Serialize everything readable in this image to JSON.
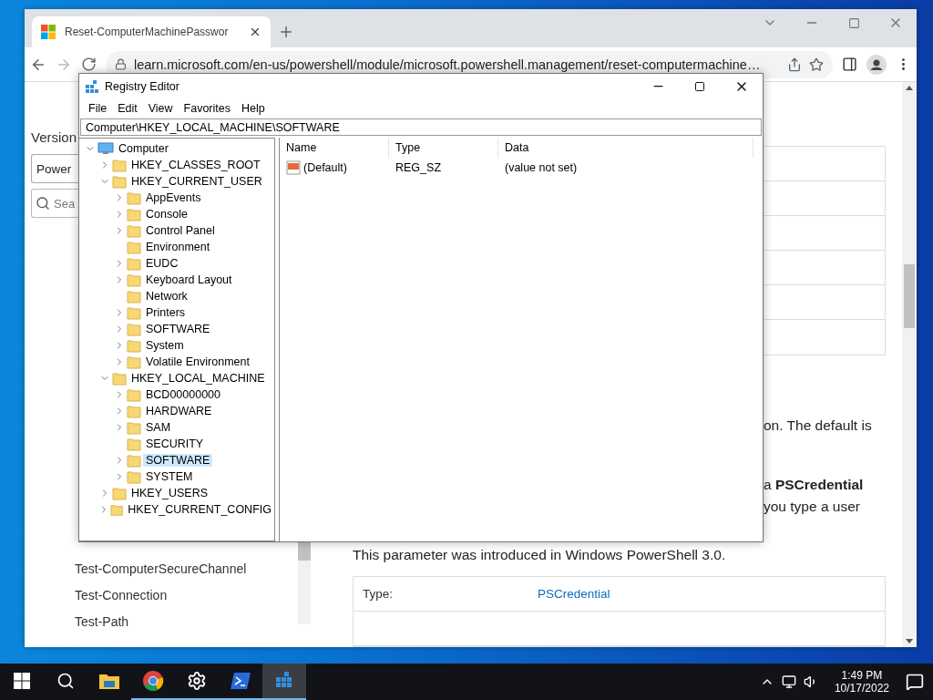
{
  "browser": {
    "tab": {
      "title": "Reset-ComputerMachinePasswor",
      "selected": true
    },
    "address": "learn.microsoft.com/en-us/powershell/module/microsoft.powershell.management/reset-computermachine…",
    "forward_disabled": true,
    "sidebar": {
      "heading": "Version",
      "version_value": "Power",
      "search_placeholder": "Sea",
      "items": [
        "Test-ComputerSecureChannel",
        "Test-Connection",
        "Test-Path"
      ]
    },
    "content": {
      "fragments": [
        "on. The default is",
        "a **PSCredential**",
        "you type a user"
      ],
      "paragraph": "This parameter was introduced in Windows PowerShell 3.0.",
      "param_table": [
        {
          "label": "Type:",
          "value": "PSCredential"
        }
      ]
    }
  },
  "regedit": {
    "title": "Registry Editor",
    "menu": [
      "File",
      "Edit",
      "View",
      "Favorites",
      "Help"
    ],
    "address": "Computer\\HKEY_LOCAL_MACHINE\\SOFTWARE",
    "tree": [
      {
        "label": "Computer",
        "kind": "computer",
        "expandable": true,
        "expanded": true,
        "selected": false,
        "children": [
          {
            "label": "HKEY_CLASSES_ROOT",
            "expandable": true,
            "expanded": false,
            "selected": false
          },
          {
            "label": "HKEY_CURRENT_USER",
            "expandable": true,
            "expanded": true,
            "selected": false,
            "children": [
              {
                "label": "AppEvents",
                "expandable": true,
                "expanded": false,
                "selected": false
              },
              {
                "label": "Console",
                "expandable": true,
                "expanded": false,
                "selected": false
              },
              {
                "label": "Control Panel",
                "expandable": true,
                "expanded": false,
                "selected": false
              },
              {
                "label": "Environment",
                "expandable": false,
                "expanded": false,
                "selected": false
              },
              {
                "label": "EUDC",
                "expandable": true,
                "expanded": false,
                "selected": false
              },
              {
                "label": "Keyboard Layout",
                "expandable": true,
                "expanded": false,
                "selected": false
              },
              {
                "label": "Network",
                "expandable": false,
                "expanded": false,
                "selected": false
              },
              {
                "label": "Printers",
                "expandable": true,
                "expanded": false,
                "selected": false
              },
              {
                "label": "SOFTWARE",
                "expandable": true,
                "expanded": false,
                "selected": false
              },
              {
                "label": "System",
                "expandable": true,
                "expanded": false,
                "selected": false
              },
              {
                "label": "Volatile Environment",
                "expandable": true,
                "expanded": false,
                "selected": false
              }
            ]
          },
          {
            "label": "HKEY_LOCAL_MACHINE",
            "expandable": true,
            "expanded": true,
            "selected": false,
            "children": [
              {
                "label": "BCD00000000",
                "expandable": true,
                "expanded": false,
                "selected": false
              },
              {
                "label": "HARDWARE",
                "expandable": true,
                "expanded": false,
                "selected": false
              },
              {
                "label": "SAM",
                "expandable": true,
                "expanded": false,
                "selected": false
              },
              {
                "label": "SECURITY",
                "expandable": false,
                "expanded": false,
                "selected": false
              },
              {
                "label": "SOFTWARE",
                "expandable": true,
                "expanded": false,
                "selected": true
              },
              {
                "label": "SYSTEM",
                "expandable": true,
                "expanded": false,
                "selected": false
              }
            ]
          },
          {
            "label": "HKEY_USERS",
            "expandable": true,
            "expanded": false,
            "selected": false
          },
          {
            "label": "HKEY_CURRENT_CONFIG",
            "expandable": true,
            "expanded": false,
            "selected": false
          }
        ]
      }
    ],
    "columns": [
      "Name",
      "Type",
      "Data"
    ],
    "values": [
      {
        "name": "(Default)",
        "type": "REG_SZ",
        "data": "(value not set)"
      }
    ]
  },
  "taskbar": {
    "apps": [
      {
        "kind": "explorer",
        "running": false,
        "selected": false
      },
      {
        "kind": "chrome",
        "running": true,
        "selected": false
      },
      {
        "kind": "settings",
        "running": true,
        "selected": false
      },
      {
        "kind": "powershell",
        "running": true,
        "selected": false
      },
      {
        "kind": "regedit",
        "running": true,
        "selected": true
      }
    ],
    "time": "1:49 PM",
    "date": "10/17/2022"
  }
}
